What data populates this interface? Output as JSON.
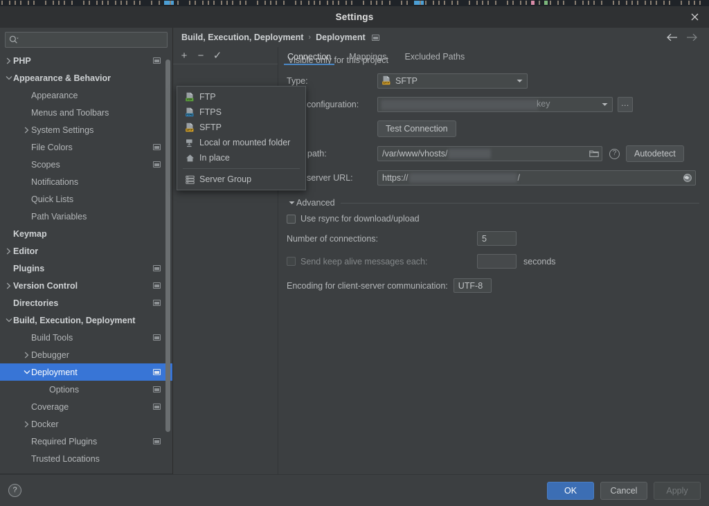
{
  "window": {
    "title": "Settings",
    "close_label": "✕"
  },
  "search": {
    "placeholder": "",
    "value": "",
    "icon": "search-icon"
  },
  "sidebar": {
    "items": [
      {
        "label": "PHP",
        "indent": 0,
        "arrow": "right",
        "bold": true,
        "badge": true,
        "selected": false
      },
      {
        "label": "Appearance & Behavior",
        "indent": 0,
        "arrow": "down",
        "bold": true,
        "badge": false,
        "selected": false
      },
      {
        "label": "Appearance",
        "indent": 1,
        "arrow": "",
        "bold": false,
        "badge": false,
        "selected": false
      },
      {
        "label": "Menus and Toolbars",
        "indent": 1,
        "arrow": "",
        "bold": false,
        "badge": false,
        "selected": false
      },
      {
        "label": "System Settings",
        "indent": 1,
        "arrow": "right",
        "bold": false,
        "badge": false,
        "selected": false
      },
      {
        "label": "File Colors",
        "indent": 1,
        "arrow": "",
        "bold": false,
        "badge": true,
        "selected": false
      },
      {
        "label": "Scopes",
        "indent": 1,
        "arrow": "",
        "bold": false,
        "badge": true,
        "selected": false
      },
      {
        "label": "Notifications",
        "indent": 1,
        "arrow": "",
        "bold": false,
        "badge": false,
        "selected": false
      },
      {
        "label": "Quick Lists",
        "indent": 1,
        "arrow": "",
        "bold": false,
        "badge": false,
        "selected": false
      },
      {
        "label": "Path Variables",
        "indent": 1,
        "arrow": "",
        "bold": false,
        "badge": false,
        "selected": false
      },
      {
        "label": "Keymap",
        "indent": 0,
        "arrow": "",
        "bold": true,
        "badge": false,
        "selected": false
      },
      {
        "label": "Editor",
        "indent": 0,
        "arrow": "right",
        "bold": true,
        "badge": false,
        "selected": false
      },
      {
        "label": "Plugins",
        "indent": 0,
        "arrow": "",
        "bold": true,
        "badge": true,
        "selected": false
      },
      {
        "label": "Version Control",
        "indent": 0,
        "arrow": "right",
        "bold": true,
        "badge": true,
        "selected": false
      },
      {
        "label": "Directories",
        "indent": 0,
        "arrow": "",
        "bold": true,
        "badge": true,
        "selected": false
      },
      {
        "label": "Build, Execution, Deployment",
        "indent": 0,
        "arrow": "down",
        "bold": true,
        "badge": false,
        "selected": false
      },
      {
        "label": "Build Tools",
        "indent": 1,
        "arrow": "",
        "bold": false,
        "badge": true,
        "selected": false
      },
      {
        "label": "Debugger",
        "indent": 1,
        "arrow": "right",
        "bold": false,
        "badge": false,
        "selected": false
      },
      {
        "label": "Deployment",
        "indent": 1,
        "arrow": "down",
        "bold": false,
        "badge": true,
        "selected": true
      },
      {
        "label": "Options",
        "indent": 2,
        "arrow": "",
        "bold": false,
        "badge": true,
        "selected": false
      },
      {
        "label": "Coverage",
        "indent": 1,
        "arrow": "",
        "bold": false,
        "badge": true,
        "selected": false
      },
      {
        "label": "Docker",
        "indent": 1,
        "arrow": "right",
        "bold": false,
        "badge": false,
        "selected": false
      },
      {
        "label": "Required Plugins",
        "indent": 1,
        "arrow": "",
        "bold": false,
        "badge": true,
        "selected": false
      },
      {
        "label": "Trusted Locations",
        "indent": 1,
        "arrow": "",
        "bold": false,
        "badge": false,
        "selected": false
      }
    ]
  },
  "breadcrumb": {
    "root": "Build, Execution, Deployment",
    "separator": "›",
    "current": "Deployment",
    "back_icon": "arrow-left-icon",
    "forward_icon": "arrow-right-icon"
  },
  "list_toolbar": {
    "add_label": "+",
    "remove_label": "−",
    "default_label": "✓"
  },
  "tabs": [
    {
      "label": "Connection",
      "active": true
    },
    {
      "label": "Mappings",
      "active": false
    },
    {
      "label": "Excluded Paths",
      "active": false
    }
  ],
  "popup_menu": {
    "items": [
      {
        "label": "FTP",
        "icon": "ftp-icon",
        "badge_text": "FTP",
        "badge_color": "#5a9e3a"
      },
      {
        "label": "FTPS",
        "icon": "ftps-icon",
        "badge_text": "FTPS",
        "badge_color": "#2f7fb5"
      },
      {
        "label": "SFTP",
        "icon": "sftp-icon",
        "badge_text": "SFTP",
        "badge_color": "#d8a127"
      },
      {
        "label": "Local or mounted folder",
        "icon": "local-folder-icon",
        "badge_text": "",
        "badge_color": ""
      },
      {
        "label": "In place",
        "icon": "home-icon",
        "badge_text": "",
        "badge_color": ""
      }
    ],
    "group_item": {
      "label": "Server Group",
      "icon": "server-group-icon"
    }
  },
  "form": {
    "visible_only_label": "Visible only for this project",
    "type_label": "Type:",
    "type_value": "SFTP",
    "type_icon": "sftp-icon",
    "ssh_label": "SSH configuration:",
    "ssh_value_tail": "key",
    "ssh_browse_label": "...",
    "test_connection_label": "Test Connection",
    "root_path_label": "Root path:",
    "root_path_value": "/var/www/vhosts/",
    "root_path_folder_icon": "folder-icon",
    "root_path_help_icon": "help-circle-icon",
    "autodetect_label": "Autodetect",
    "web_url_label": "Web server URL:",
    "web_url_value": "https://",
    "web_url_tail": "/",
    "web_url_globe_icon": "globe-icon",
    "advanced_label": "Advanced",
    "rsync_label": "Use rsync for download/upload",
    "rsync_checked": false,
    "connections_label": "Number of connections:",
    "connections_value": "5",
    "keepalive_label": "Send keep alive messages each:",
    "keepalive_checked": false,
    "keepalive_value": "",
    "seconds_label": "seconds",
    "encoding_label": "Encoding for client-server communication:",
    "encoding_value": "UTF-8"
  },
  "footer": {
    "help_label": "?",
    "ok_label": "OK",
    "cancel_label": "Cancel",
    "apply_label": "Apply"
  },
  "colors": {
    "selection_blue": "#3875d6",
    "tab_underline": "#4a88c7",
    "ok_button": "#3c6eb4",
    "panel_bg": "#3c3f41",
    "titlebar_bg": "#2f3133"
  }
}
